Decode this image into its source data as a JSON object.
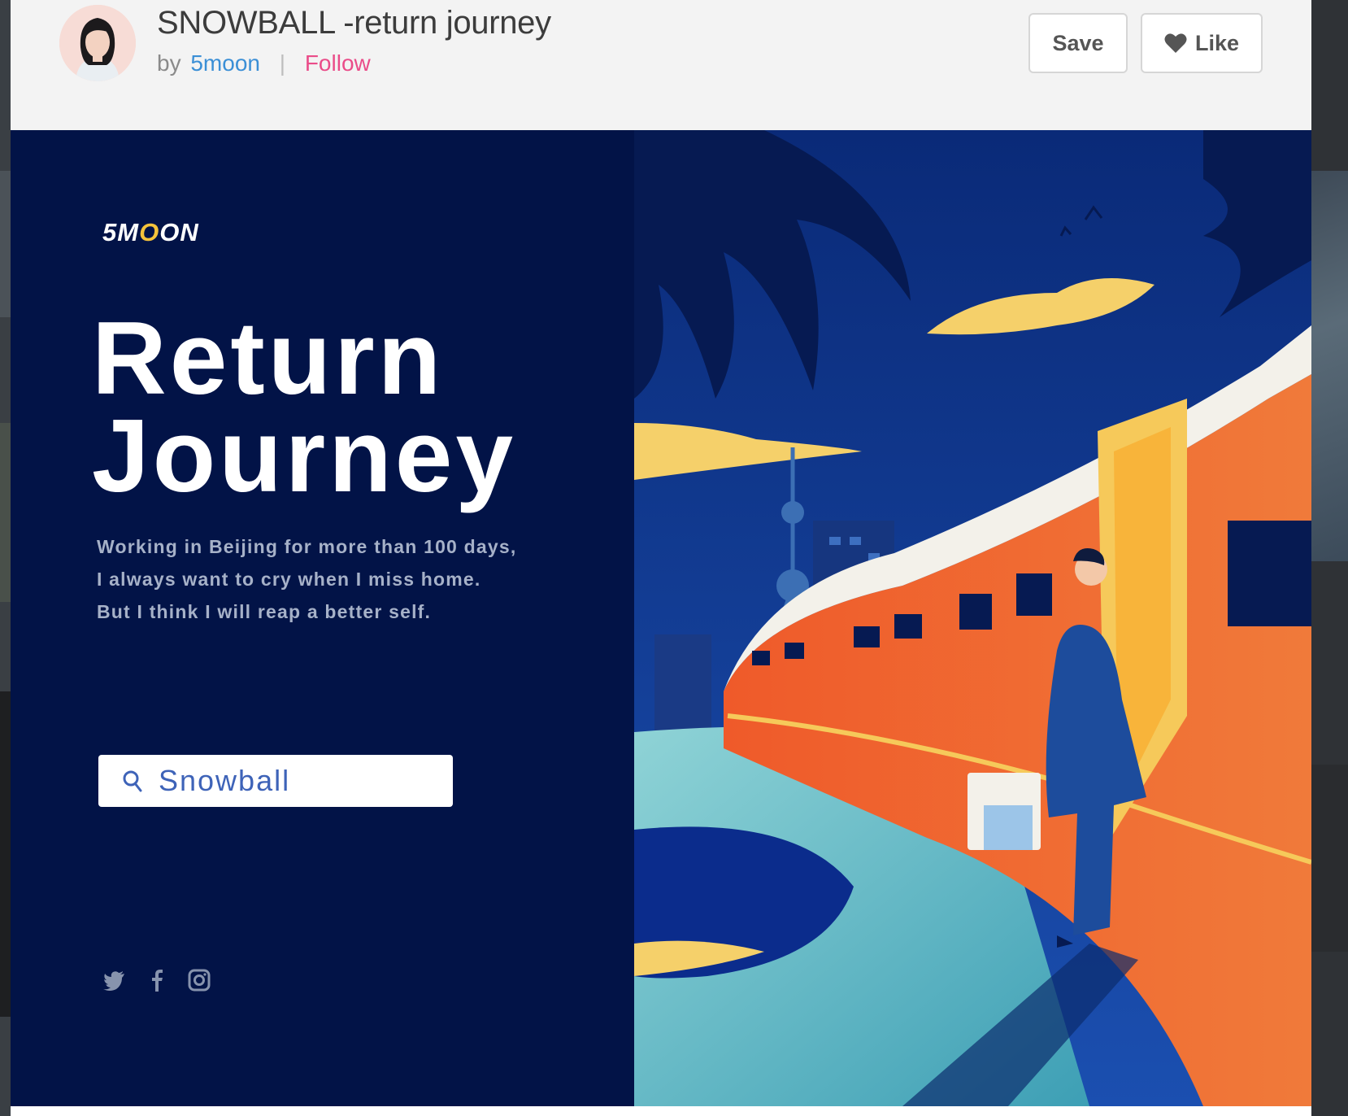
{
  "shot": {
    "title": "SNOWBALL -return journey",
    "by_label": "by",
    "author": "5moon",
    "separator": "|",
    "follow_label": "Follow",
    "save_label": "Save",
    "like_label": "Like",
    "like_icon": "heart-icon"
  },
  "artwork": {
    "brand": {
      "prefix": "5M",
      "highlight": "O",
      "suffix": "ON"
    },
    "headline": "Return\nJourney",
    "tagline": [
      "Working in Beijing for more than 100 days,",
      "I always want to cry when I miss home.",
      "But I think I will reap a better self."
    ],
    "search_value": "Snowball",
    "social_icons": [
      "twitter-icon",
      "facebook-icon",
      "instagram-icon"
    ]
  },
  "colors": {
    "accent_link": "#3b8fd6",
    "follow": "#ea4c89",
    "navy": "#021347",
    "train_orange": "#ef5a2a",
    "sky_blue": "#0c2f80"
  }
}
